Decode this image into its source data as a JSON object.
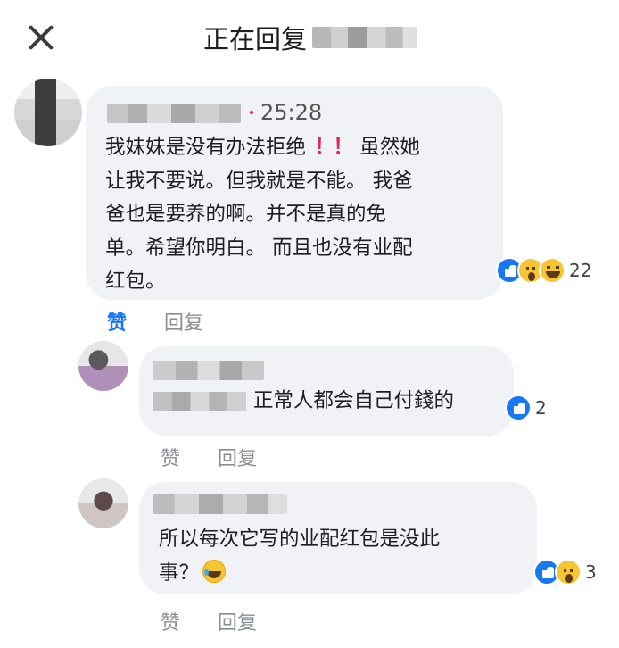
{
  "header": {
    "title": "正在回复"
  },
  "comments": [
    {
      "timestamp": "25:28",
      "text_parts": [
        "我妹妹是没有办法拒绝 ",
        "！！",
        " 虽然她\n让我不要说。但我就是不能。 我爸\n爸也是要养的啊。并不是真的免\n单。希望你明白。 而且也没有业配\n红包。"
      ],
      "reactions": [
        "like-icon",
        "wow-icon",
        "haha-icon"
      ],
      "reaction_count": "22",
      "actions": {
        "like": "赞",
        "reply": "回复"
      },
      "liked": true
    },
    {
      "text": "正常人都会自己付錢的",
      "reactions": [
        "like-icon"
      ],
      "reaction_count": "2",
      "actions": {
        "like": "赞",
        "reply": "回复"
      },
      "liked": false
    },
    {
      "text": "所以每次它写的业配红包是没此\n事？",
      "emoji": "rolling-on-floor-laughing-emoji",
      "reactions": [
        "like-icon",
        "wow-icon"
      ],
      "reaction_count": "3",
      "actions": {
        "like": "赞",
        "reply": "回复"
      },
      "liked": false
    }
  ],
  "colors": {
    "bubble": "#f0f2f5",
    "accent": "#1877f2",
    "muted": "#8a8d91",
    "text": "#1c1e21",
    "timestamp_dot": "#e0245e"
  }
}
